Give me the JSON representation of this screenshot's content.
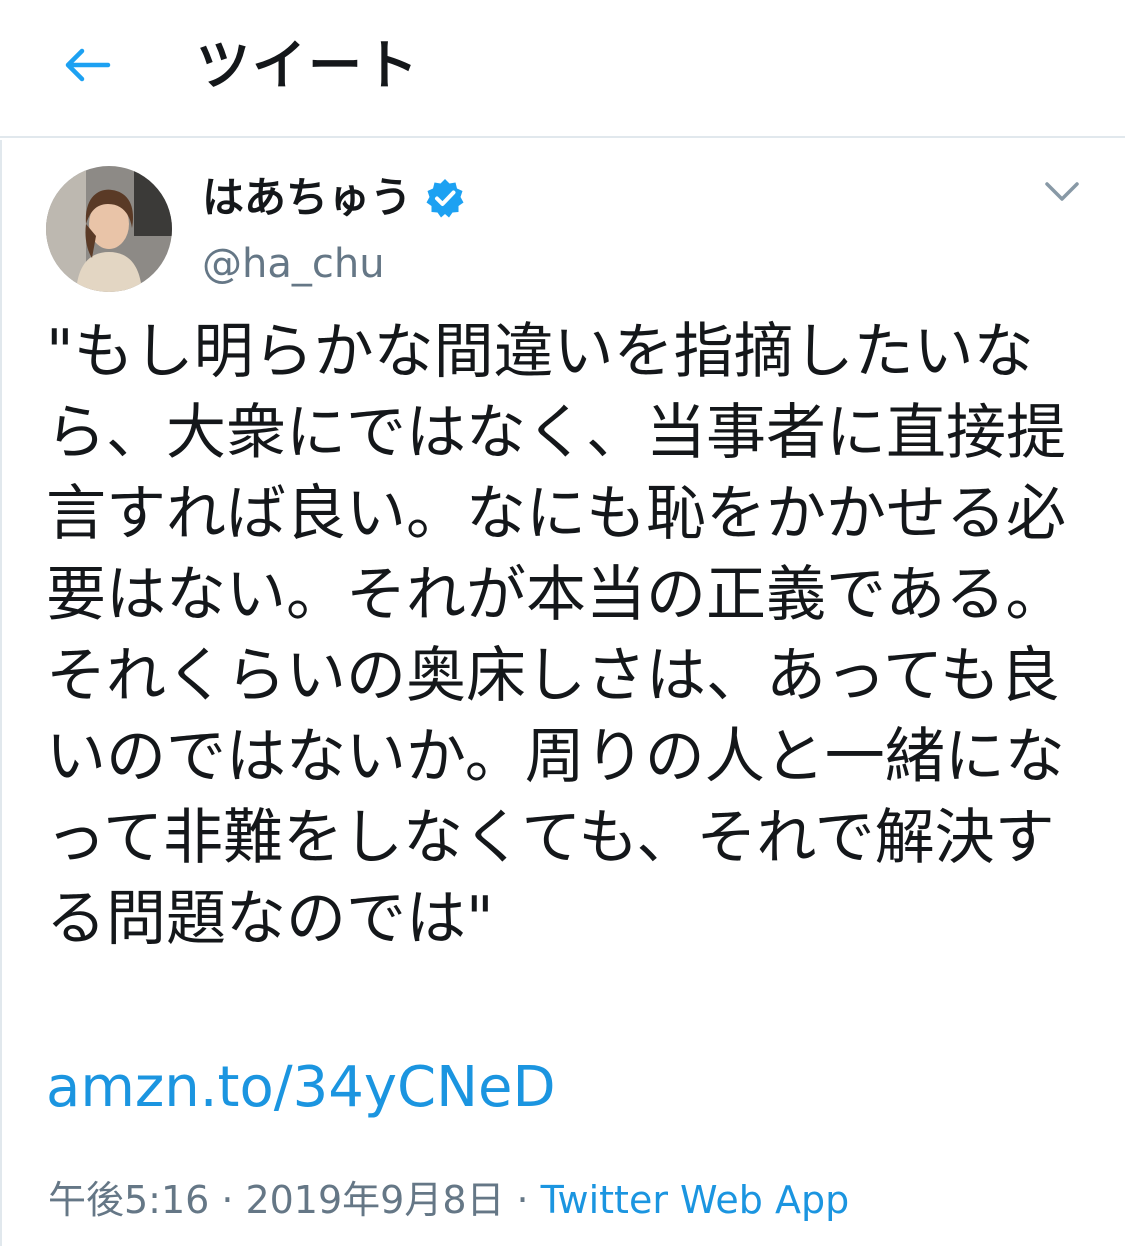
{
  "header": {
    "title": "ツイート",
    "back_icon": "arrow-left-icon",
    "accent": "#1da1f2"
  },
  "tweet": {
    "user": {
      "display_name": "はあちゅう",
      "handle": "@ha_chu",
      "verified": true,
      "verified_icon": "verified-badge-icon"
    },
    "menu_icon": "chevron-down-icon",
    "text": "\"もし明らかな間違いを指摘したいなら、大衆にではなく、当事者に直接提言すれば良い。なにも恥をかかせる必要はない。それが本当の正義である。それくらいの奥床しさは、あっても良いのではないか。周りの人と一緒になって非難をしなくても、それで解決する問題なのでは\"",
    "link": "amzn.to/34yCNeD",
    "time": "午後5:16",
    "separator": "·",
    "date": "2019年9月8日",
    "source": "Twitter Web App"
  },
  "colors": {
    "link": "#1b95e0",
    "secondary_text": "#657786",
    "border": "#e1e8ed"
  }
}
